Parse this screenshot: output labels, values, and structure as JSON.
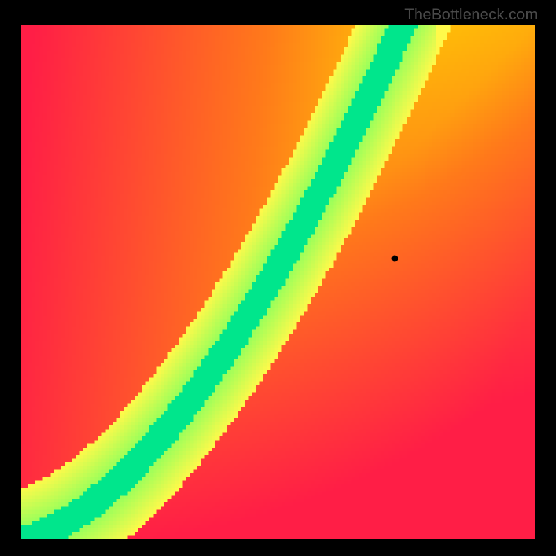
{
  "watermark": "TheBottleneck.com",
  "chart_data": {
    "type": "heatmap",
    "title": "",
    "xlabel": "",
    "ylabel": "",
    "xlim": [
      0,
      1
    ],
    "ylim": [
      0,
      1
    ],
    "grid": false,
    "legend": false,
    "marker": {
      "x": 0.727,
      "y": 0.546
    },
    "crosshair": {
      "x": 0.727,
      "y": 0.546
    },
    "optimal_curve": {
      "description": "green ridge where scaled GPU matches CPU",
      "x": [
        0.0,
        0.1,
        0.2,
        0.3,
        0.4,
        0.5,
        0.6,
        0.7,
        0.8,
        0.9,
        1.0
      ],
      "y": [
        0.0,
        0.09,
        0.2,
        0.35,
        0.51,
        0.66,
        0.79,
        0.9,
        1.0,
        1.0,
        1.0
      ]
    },
    "colorscale": {
      "0.00": "#ff1e46",
      "0.35": "#ff7a1a",
      "0.60": "#ffd600",
      "0.80": "#fff94a",
      "0.92": "#9bff5a",
      "1.00": "#00e68c"
    },
    "resolution": 140
  }
}
